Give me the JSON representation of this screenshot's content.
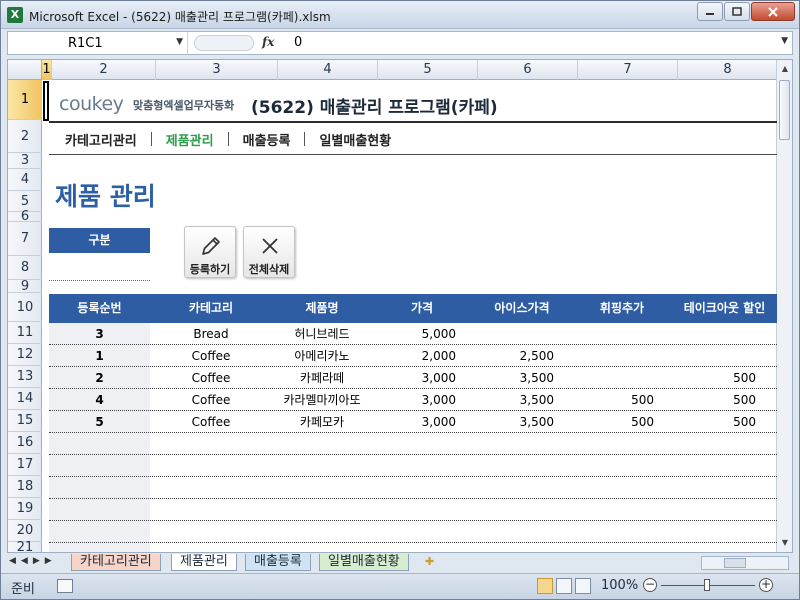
{
  "window": {
    "title": "Microsoft Excel - (5622) 매출관리 프로그램(카페).xlsm",
    "app_icon": "excel-icon"
  },
  "formula_bar": {
    "name_box": "R1C1",
    "fx_label": "fx",
    "value": "0"
  },
  "columns": [
    "1",
    "2",
    "3",
    "4",
    "5",
    "6",
    "7",
    "8"
  ],
  "rows": [
    "1",
    "2",
    "3",
    "4",
    "5",
    "6",
    "7",
    "8",
    "9",
    "10",
    "11",
    "12",
    "13",
    "14",
    "15",
    "16",
    "17",
    "18",
    "19",
    "20",
    "21"
  ],
  "sheet": {
    "logo_brand": "coukey",
    "logo_sub": "맞춤형엑셀업무자동화",
    "doc_title": "(5622) 매출관리 프로그램(카페)",
    "nav": [
      "카테고리관리",
      "제품관리",
      "매출등록",
      "일별매출현황"
    ],
    "nav_active_index": 1,
    "page_title": "제품 관리",
    "filter_label": "구분",
    "filter_value": "",
    "buttons": {
      "register": {
        "label": "등록하기",
        "icon": "pencil-icon"
      },
      "delete_all": {
        "label": "전체삭제",
        "icon": "close-x-icon"
      }
    },
    "table": {
      "headers": [
        "등록순번",
        "카테고리",
        "제품명",
        "가격",
        "아이스가격",
        "휘핑추가",
        "테이크아웃 할인"
      ],
      "rows": [
        [
          "3",
          "Bread",
          "허니브레드",
          "5,000",
          "",
          "",
          ""
        ],
        [
          "1",
          "Coffee",
          "아메리카노",
          "2,000",
          "2,500",
          "",
          ""
        ],
        [
          "2",
          "Coffee",
          "카페라떼",
          "3,000",
          "3,500",
          "",
          "500"
        ],
        [
          "4",
          "Coffee",
          "카라멜마끼아또",
          "3,000",
          "3,500",
          "500",
          "500"
        ],
        [
          "5",
          "Coffee",
          "카페모카",
          "3,000",
          "3,500",
          "500",
          "500"
        ]
      ]
    }
  },
  "sheet_tabs": [
    "카테고리관리",
    "제품관리",
    "매출등록",
    "일별매출현황"
  ],
  "active_sheet_index": 1,
  "status": {
    "ready": "준비",
    "zoom": "100%"
  },
  "colors": {
    "header_blue": "#2f5da4",
    "title_blue": "#2d5fa5",
    "nav_active_green": "#2e9b4a",
    "logo_orange": "#e89a2b"
  }
}
